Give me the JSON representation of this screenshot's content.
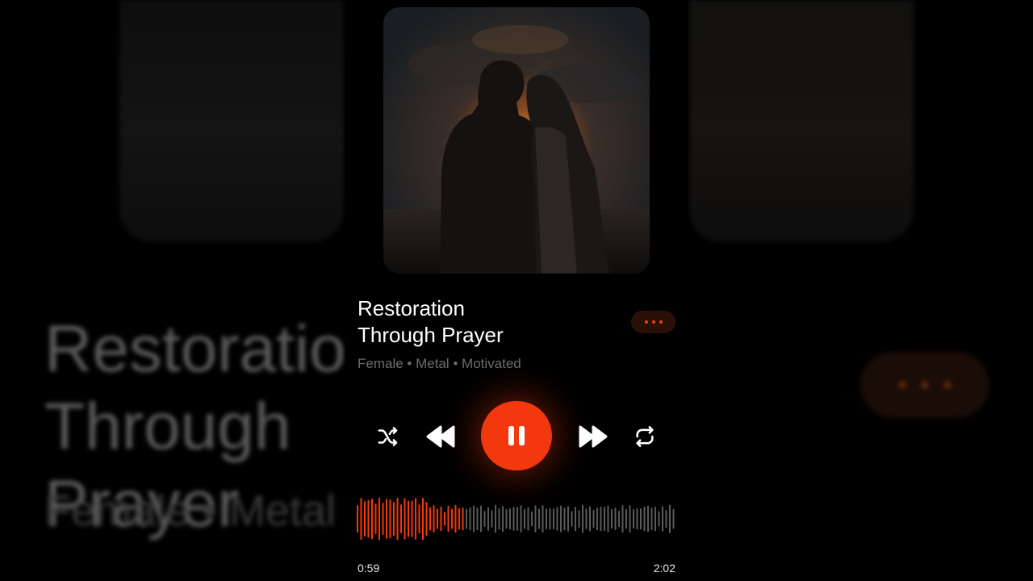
{
  "track": {
    "title": "Restoration\nThrough Prayer",
    "tags": "Female • Metal • Motivated"
  },
  "background_echo": {
    "title": "Restoration\nThrough Prayer",
    "tags": "Female • Metal • Motivated"
  },
  "controls": {
    "more": "more-options-icon",
    "shuffle": "shuffle-icon",
    "previous": "rewind-icon",
    "play_pause": "pause-icon",
    "next": "fast-forward-icon",
    "repeat": "repeat-icon"
  },
  "progress": {
    "current_time": "0:59",
    "total_time": "2:02",
    "played_fraction": 0.33
  },
  "colors": {
    "accent": "#f2380c",
    "waveform_unplayed": "#5a5a5a",
    "subtitle": "#6c6c6c",
    "background": "#000000"
  }
}
